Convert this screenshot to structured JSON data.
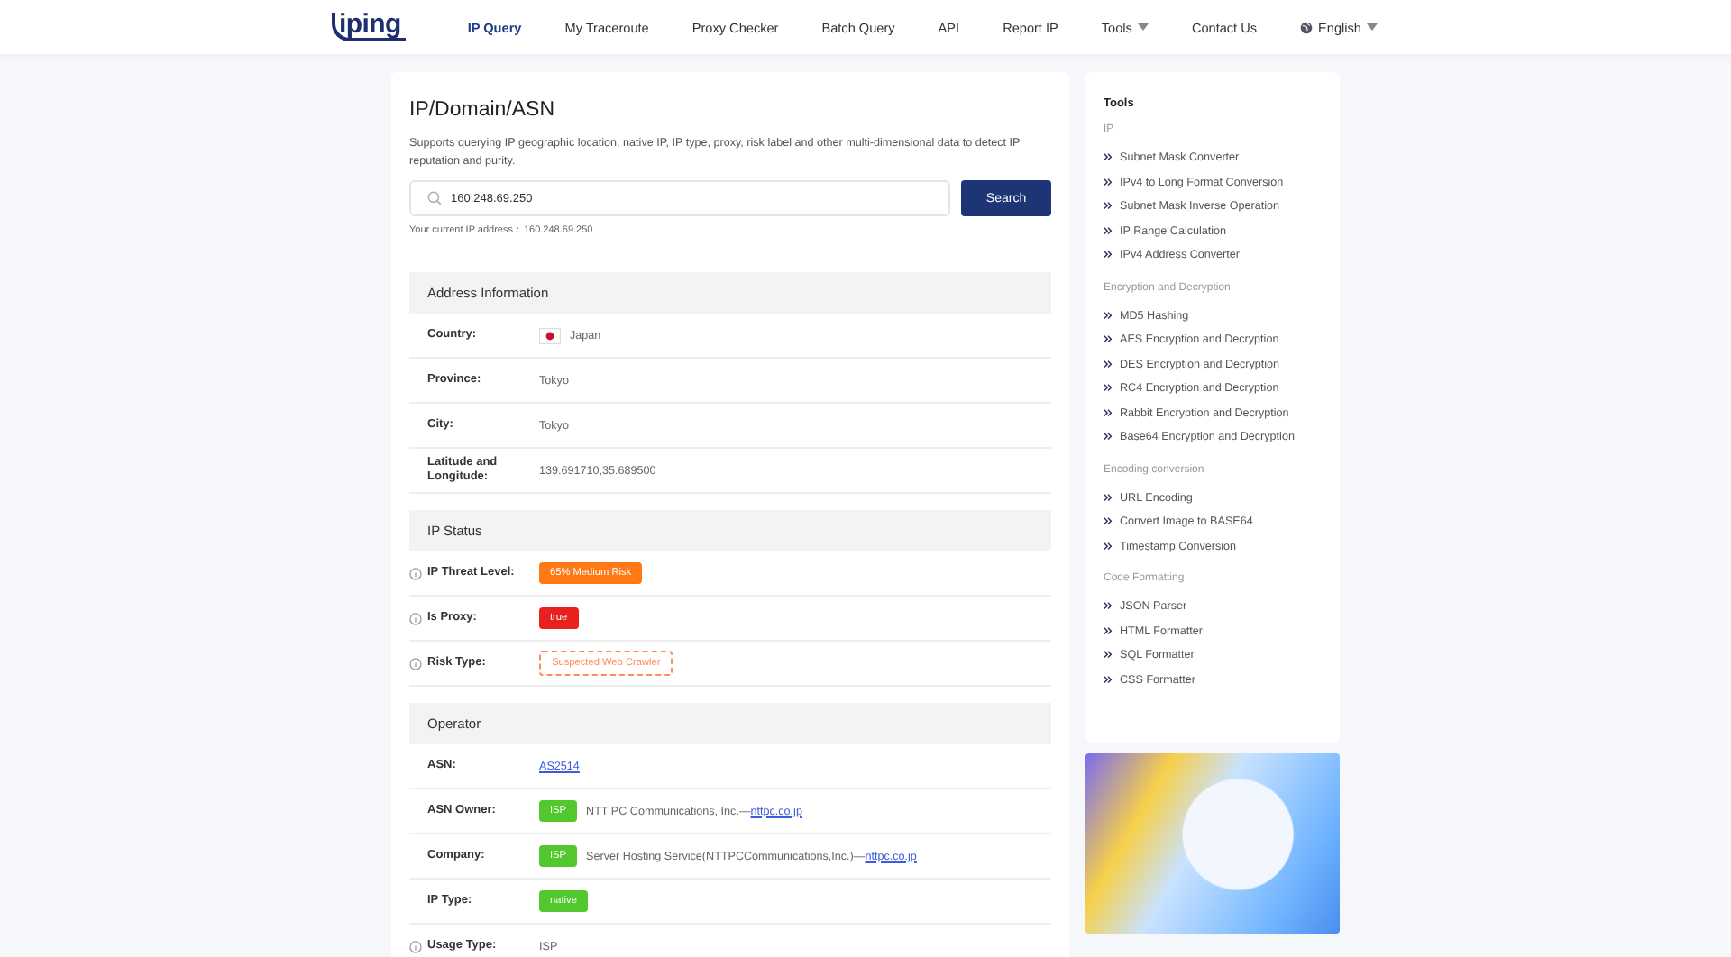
{
  "nav": {
    "logo": "iping",
    "items": [
      {
        "label": "IP Query",
        "selected": true,
        "dropdown": false
      },
      {
        "label": "My Traceroute",
        "selected": false,
        "dropdown": false
      },
      {
        "label": "Proxy Checker",
        "selected": false,
        "dropdown": false
      },
      {
        "label": "Batch Query",
        "selected": false,
        "dropdown": false
      },
      {
        "label": "API",
        "selected": false,
        "dropdown": false
      },
      {
        "label": "Report IP",
        "selected": false,
        "dropdown": false
      },
      {
        "label": "Tools",
        "selected": false,
        "dropdown": true
      },
      {
        "label": "Contact Us",
        "selected": false,
        "dropdown": false
      }
    ],
    "language": "English"
  },
  "main": {
    "title": "IP/Domain/ASN",
    "description": "Supports querying IP geographic location, native IP, IP type, proxy, risk label and other multi-dimensional data to detect IP reputation and purity.",
    "search": {
      "value": "160.248.69.250",
      "button": "Search"
    },
    "current_ip": "Your current IP address：160.248.69.250",
    "sections": [
      {
        "title": "Address Information",
        "rows": [
          {
            "label": "Country:",
            "info": false,
            "kind": "country",
            "value": "Japan"
          },
          {
            "label": "Province:",
            "info": false,
            "kind": "text",
            "value": "Tokyo"
          },
          {
            "label": "City:",
            "info": false,
            "kind": "text",
            "value": "Tokyo"
          },
          {
            "label": "Latitude and Longitude:",
            "info": false,
            "kind": "text",
            "value": "139.691710,35.689500"
          }
        ]
      },
      {
        "title": "IP Status",
        "rows": [
          {
            "label": "IP Threat Level:",
            "info": true,
            "kind": "badge",
            "value": "65% Medium Risk",
            "color": "#ff7a14"
          },
          {
            "label": "Is Proxy:",
            "info": true,
            "kind": "badge",
            "value": "true",
            "color": "#e8201e"
          },
          {
            "label": "Risk Type:",
            "info": true,
            "kind": "outline",
            "value": "Suspected Web Crawler",
            "color": "#ff8a5c"
          }
        ]
      },
      {
        "title": "Operator",
        "rows": [
          {
            "label": "ASN:",
            "info": false,
            "kind": "link",
            "value": "AS2514"
          },
          {
            "label": "ASN Owner:",
            "info": false,
            "kind": "tagged",
            "tag": "ISP",
            "color": "#52c72e",
            "value": "NTT PC Communications, Inc.—",
            "link": "nttpc.co.jp"
          },
          {
            "label": "Company:",
            "info": false,
            "kind": "tagged",
            "tag": "ISP",
            "color": "#52c72e",
            "value": "Server Hosting Service(NTTPCCommunications,Inc.)—",
            "link": "nttpc.co.jp"
          },
          {
            "label": "IP Type:",
            "info": false,
            "kind": "badge",
            "value": "native",
            "color": "#52c72e"
          },
          {
            "label": "Usage Type:",
            "info": true,
            "kind": "text",
            "value": "ISP"
          }
        ]
      }
    ]
  },
  "sidebar": {
    "title": "Tools",
    "groups": [
      {
        "name": "IP",
        "items": [
          "Subnet Mask Converter",
          "IPv4 to Long Format Conversion",
          "Subnet Mask Inverse Operation",
          "IP Range Calculation",
          "IPv4 Address Converter"
        ]
      },
      {
        "name": "Encryption and Decryption",
        "items": [
          "MD5 Hashing",
          "AES Encryption and Decryption",
          "DES Encryption and Decryption",
          "RC4 Encryption and Decryption",
          "Rabbit Encryption and Decryption",
          "Base64 Encryption and Decryption"
        ]
      },
      {
        "name": "Encoding conversion",
        "items": [
          "URL Encoding",
          "Convert Image to BASE64",
          "Timestamp Conversion"
        ]
      },
      {
        "name": "Code Formatting",
        "items": [
          "JSON Parser",
          "HTML Formatter",
          "SQL Formatter",
          "CSS Formatter"
        ]
      }
    ]
  }
}
